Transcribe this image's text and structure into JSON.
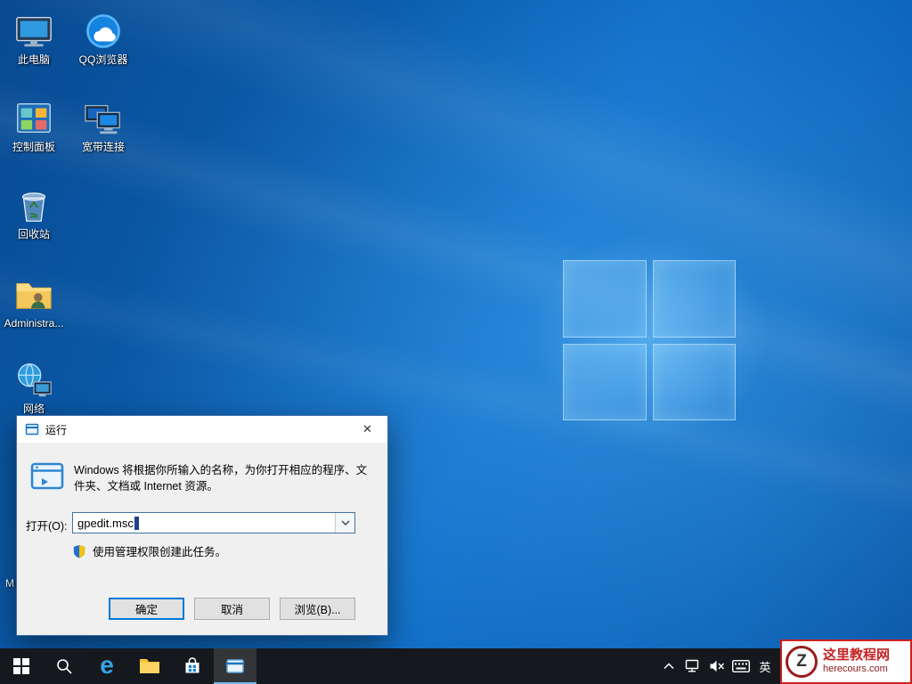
{
  "desktop": {
    "partial_label": "M",
    "icons": [
      {
        "label": "此电脑"
      },
      {
        "label": "QQ浏览器"
      },
      {
        "label": "控制面板"
      },
      {
        "label": "宽带连接"
      },
      {
        "label": "回收站"
      },
      {
        "label": "Administra..."
      },
      {
        "label": "网络"
      }
    ]
  },
  "run_dialog": {
    "title": "运行",
    "close_glyph": "✕",
    "description": "Windows 将根据你所输入的名称，为你打开相应的程序、文件夹、文档或 Internet 资源。",
    "open_label": "打开(O):",
    "input_value": "gpedit.msc",
    "admin_note": "使用管理权限创建此任务。",
    "ok_label": "确定",
    "cancel_label": "取消",
    "browse_label": "浏览(B)..."
  },
  "taskbar": {
    "edge_glyph": "e",
    "ime_label": "英"
  },
  "watermark": {
    "logo_letter": "Z",
    "site_name": "这里教程网",
    "site_url": "herecours.com"
  },
  "colors": {
    "accent": "#0078d7",
    "taskbar": "#15181c",
    "wallpaper": "#0f6ec6",
    "watermark_red": "#c52222"
  }
}
